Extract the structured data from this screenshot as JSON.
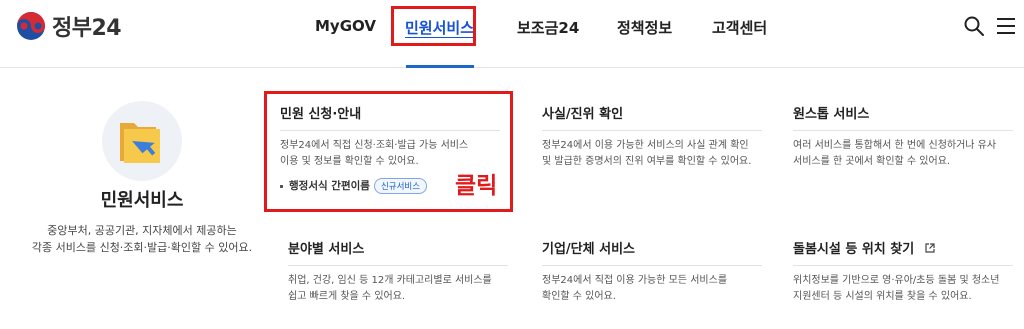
{
  "header": {
    "logo_text": "정부24",
    "nav": [
      {
        "label": "MyGOV"
      },
      {
        "label": "민원서비스"
      },
      {
        "label": "보조금24"
      },
      {
        "label": "정책정보"
      },
      {
        "label": "고객센터"
      }
    ],
    "icons": {
      "search": "search-icon",
      "menu": "menu-icon"
    }
  },
  "intro": {
    "icon": "folder-arrow-icon",
    "title": "민원서비스",
    "desc_line1": "중앙부처, 공공기관, 지자체에서 제공하는",
    "desc_line2": "각종 서비스를 신청·조회·발급·확인할 수 있어요."
  },
  "cards": [
    {
      "title": "민원 신청·안내",
      "desc_line1": "정부24에서 직접 신청·조회·발급 가능 서비스",
      "desc_line2": "이용 및 정보를 확인할 수 있어요.",
      "sub_link": "행정서식 간편이름",
      "badge": "신규서비스"
    },
    {
      "title": "사실/진위 확인",
      "desc_line1": "정부24에서 이용 가능한 서비스의 사실 관계 확인",
      "desc_line2": "및 발급한 증명서의 진위 여부를 확인할 수 있어요."
    },
    {
      "title": "원스톱 서비스",
      "desc_line1": "여러 서비스를 통합해서 한 번에 신청하거나 유사",
      "desc_line2": "서비스를 한 곳에서 확인할 수 있어요."
    },
    {
      "title": "분야별 서비스",
      "desc_line1": "취업, 건강, 임신 등 12개 카테고리별로 서비스를",
      "desc_line2": "쉽고 빠르게 찾을 수 있어요."
    },
    {
      "title": "기업/단체 서비스",
      "desc_line1": "정부24에서 직접 이용 가능한 모든 서비스를",
      "desc_line2": "확인할 수 있어요."
    },
    {
      "title": "돌봄시설 등 위치 찾기",
      "title_icon": "external-link-icon",
      "desc_line1": "위치정보를 기반으로 영·유아/초등 돌봄 및 청소년",
      "desc_line2": "지원센터 등 시설의 위치를 찾을 수 있어요."
    }
  ],
  "annotation": {
    "label": "클릭",
    "color": "#e11b1b"
  },
  "colors": {
    "accent": "#1652d6",
    "highlight": "#e11b1b"
  }
}
